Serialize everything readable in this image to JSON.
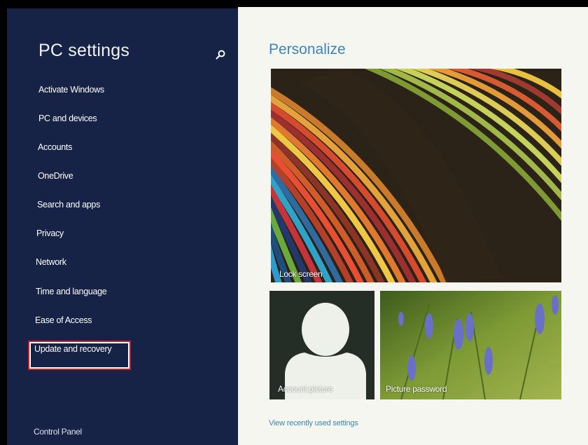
{
  "sidebar": {
    "title": "PC settings",
    "items": [
      {
        "label": "Activate Windows"
      },
      {
        "label": "PC and devices"
      },
      {
        "label": "Accounts"
      },
      {
        "label": "OneDrive"
      },
      {
        "label": "Search and apps"
      },
      {
        "label": "Privacy"
      },
      {
        "label": "Network"
      },
      {
        "label": "Time and language"
      },
      {
        "label": "Ease of Access"
      },
      {
        "label": "Update and recovery"
      }
    ],
    "control_panel": "Control Panel",
    "search_icon": "search-icon"
  },
  "main": {
    "heading": "Personalize",
    "tiles": {
      "lock_screen": "Lock screen",
      "account_picture": "Account picture",
      "picture_password": "Picture password"
    },
    "recent_link": "View recently used settings"
  },
  "colors": {
    "sidebar_bg": "#162246",
    "main_bg": "#f5f6ef",
    "accent": "#3b86b4",
    "highlight_border": "#c8202a"
  }
}
